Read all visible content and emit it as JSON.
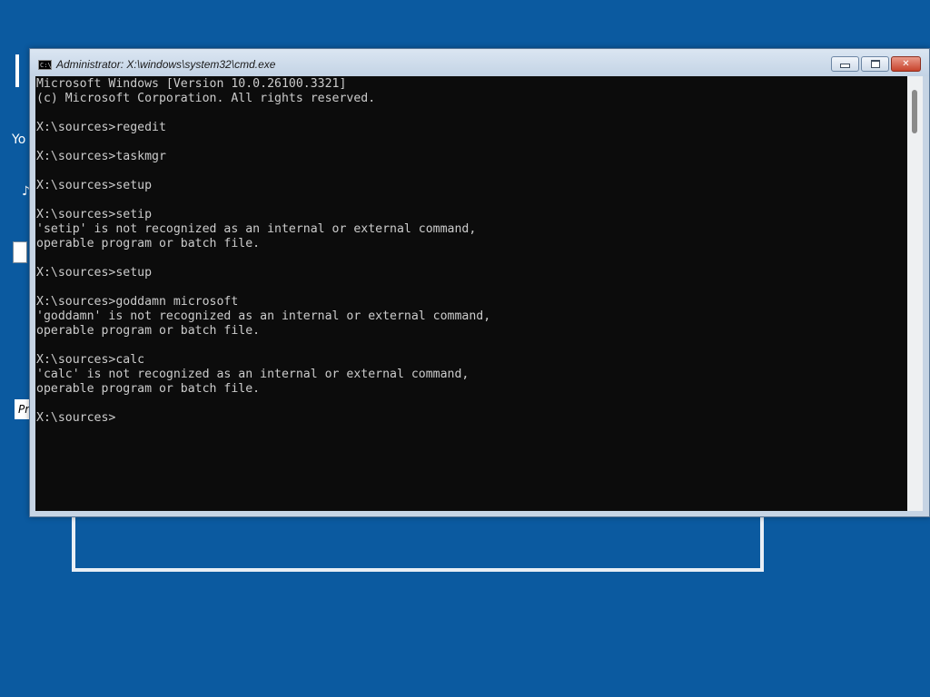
{
  "background": {
    "color": "#0b5aa0",
    "setup_text": "Yo",
    "setup_button_text": "Pr"
  },
  "window": {
    "title": "Administrator: X:\\windows\\system32\\cmd.exe",
    "icon": "cmd-icon",
    "icon_label": "C:\\",
    "buttons": {
      "minimize": "minimize-icon",
      "maximize": "maximize-icon",
      "close_label": "✕"
    }
  },
  "console": {
    "background": "#0c0c0c",
    "foreground": "#cccccc",
    "lines": [
      "Microsoft Windows [Version 10.0.26100.3321]",
      "(c) Microsoft Corporation. All rights reserved.",
      "",
      "X:\\sources>regedit",
      "",
      "X:\\sources>taskmgr",
      "",
      "X:\\sources>setup",
      "",
      "X:\\sources>setip",
      "'setip' is not recognized as an internal or external command,",
      "operable program or batch file.",
      "",
      "X:\\sources>setup",
      "",
      "X:\\sources>goddamn microsoft",
      "'goddamn' is not recognized as an internal or external command,",
      "operable program or batch file.",
      "",
      "X:\\sources>calc",
      "'calc' is not recognized as an internal or external command,",
      "operable program or batch file.",
      "",
      "X:\\sources>"
    ]
  }
}
